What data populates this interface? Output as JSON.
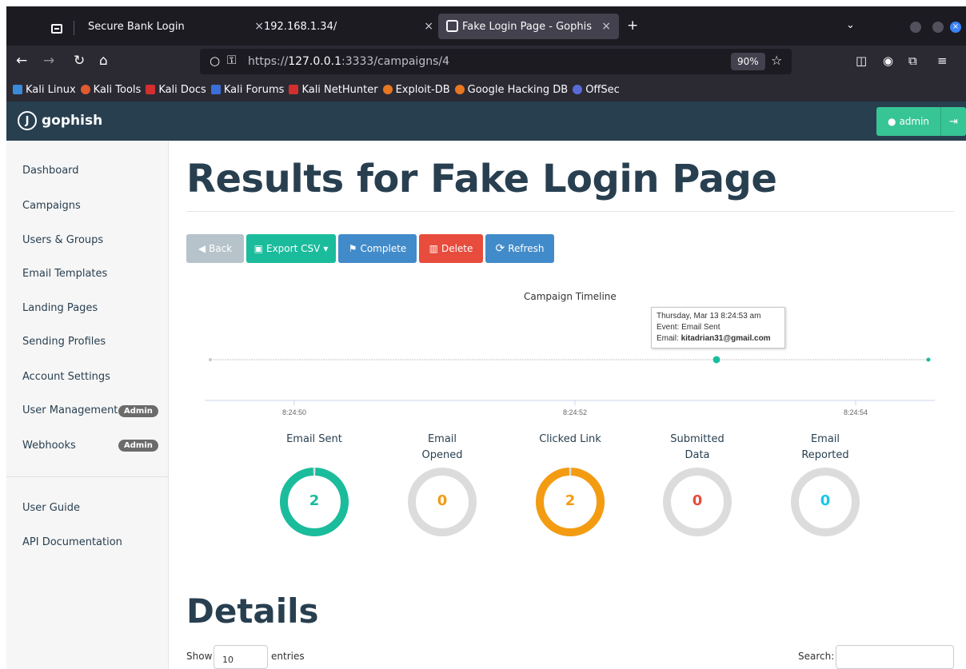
{
  "browser": {
    "tabs": [
      {
        "label": "Secure Bank Login"
      },
      {
        "label": "192.168.1.34/"
      },
      {
        "label": "Fake Login Page - Gophis"
      }
    ],
    "url_prefix": "https://",
    "url_host": "127.0.0.1",
    "url_path": ":3333/campaigns/4",
    "zoom": "90%",
    "bookmarks": [
      {
        "label": "Kali Linux",
        "color": "#3b8ad8"
      },
      {
        "label": "Kali Tools",
        "color": "#e05b2f"
      },
      {
        "label": "Kali Docs",
        "color": "#d32f2f"
      },
      {
        "label": "Kali Forums",
        "color": "#3b6fd8"
      },
      {
        "label": "Kali NetHunter",
        "color": "#d32f2f"
      },
      {
        "label": "Exploit-DB",
        "color": "#e87722"
      },
      {
        "label": "Google Hacking DB",
        "color": "#e87722"
      },
      {
        "label": "OffSec",
        "color": "#5a6bd8"
      }
    ]
  },
  "app": {
    "logo": "gophish",
    "user": "admin"
  },
  "sidebar": {
    "items": [
      {
        "label": "Dashboard"
      },
      {
        "label": "Campaigns"
      },
      {
        "label": "Users & Groups"
      },
      {
        "label": "Email Templates"
      },
      {
        "label": "Landing Pages"
      },
      {
        "label": "Sending Profiles"
      },
      {
        "label": "Account Settings"
      },
      {
        "label": "User Management",
        "badge": "Admin"
      },
      {
        "label": "Webhooks",
        "badge": "Admin"
      }
    ],
    "help_items": [
      {
        "label": "User Guide"
      },
      {
        "label": "API Documentation"
      }
    ]
  },
  "main": {
    "title": "Results for Fake Login Page",
    "buttons": {
      "back": "Back",
      "export": "Export CSV",
      "complete": "Complete",
      "delete": "Delete",
      "refresh": "Refresh"
    },
    "timeline": {
      "title": "Campaign Timeline",
      "ticks": [
        "8:24:50",
        "8:24:52",
        "8:24:54"
      ],
      "tooltip_date": "Thursday, Mar 13 8:24:53 am",
      "tooltip_event": "Event: Email Sent",
      "tooltip_email_label": "Email: ",
      "tooltip_email": "kitadrian31@gmail.com"
    },
    "stats": [
      {
        "label": "Email Sent",
        "value": "2",
        "fraction": 1,
        "color": "#1abc9c"
      },
      {
        "label": "Email Opened",
        "value": "0",
        "fraction": 0,
        "color": "#f39c12"
      },
      {
        "label": "Clicked Link",
        "value": "2",
        "fraction": 1,
        "color": "#f39c12"
      },
      {
        "label": "Submitted Data",
        "value": "0",
        "fraction": 0,
        "color": "#e74c3c"
      },
      {
        "label": "Email Reported",
        "value": "0",
        "fraction": 0,
        "color": "#17c8e4"
      }
    ],
    "details_title": "Details",
    "table_controls": {
      "show": "Show",
      "entries_value": "10",
      "entries": "entries",
      "search": "Search:"
    }
  }
}
